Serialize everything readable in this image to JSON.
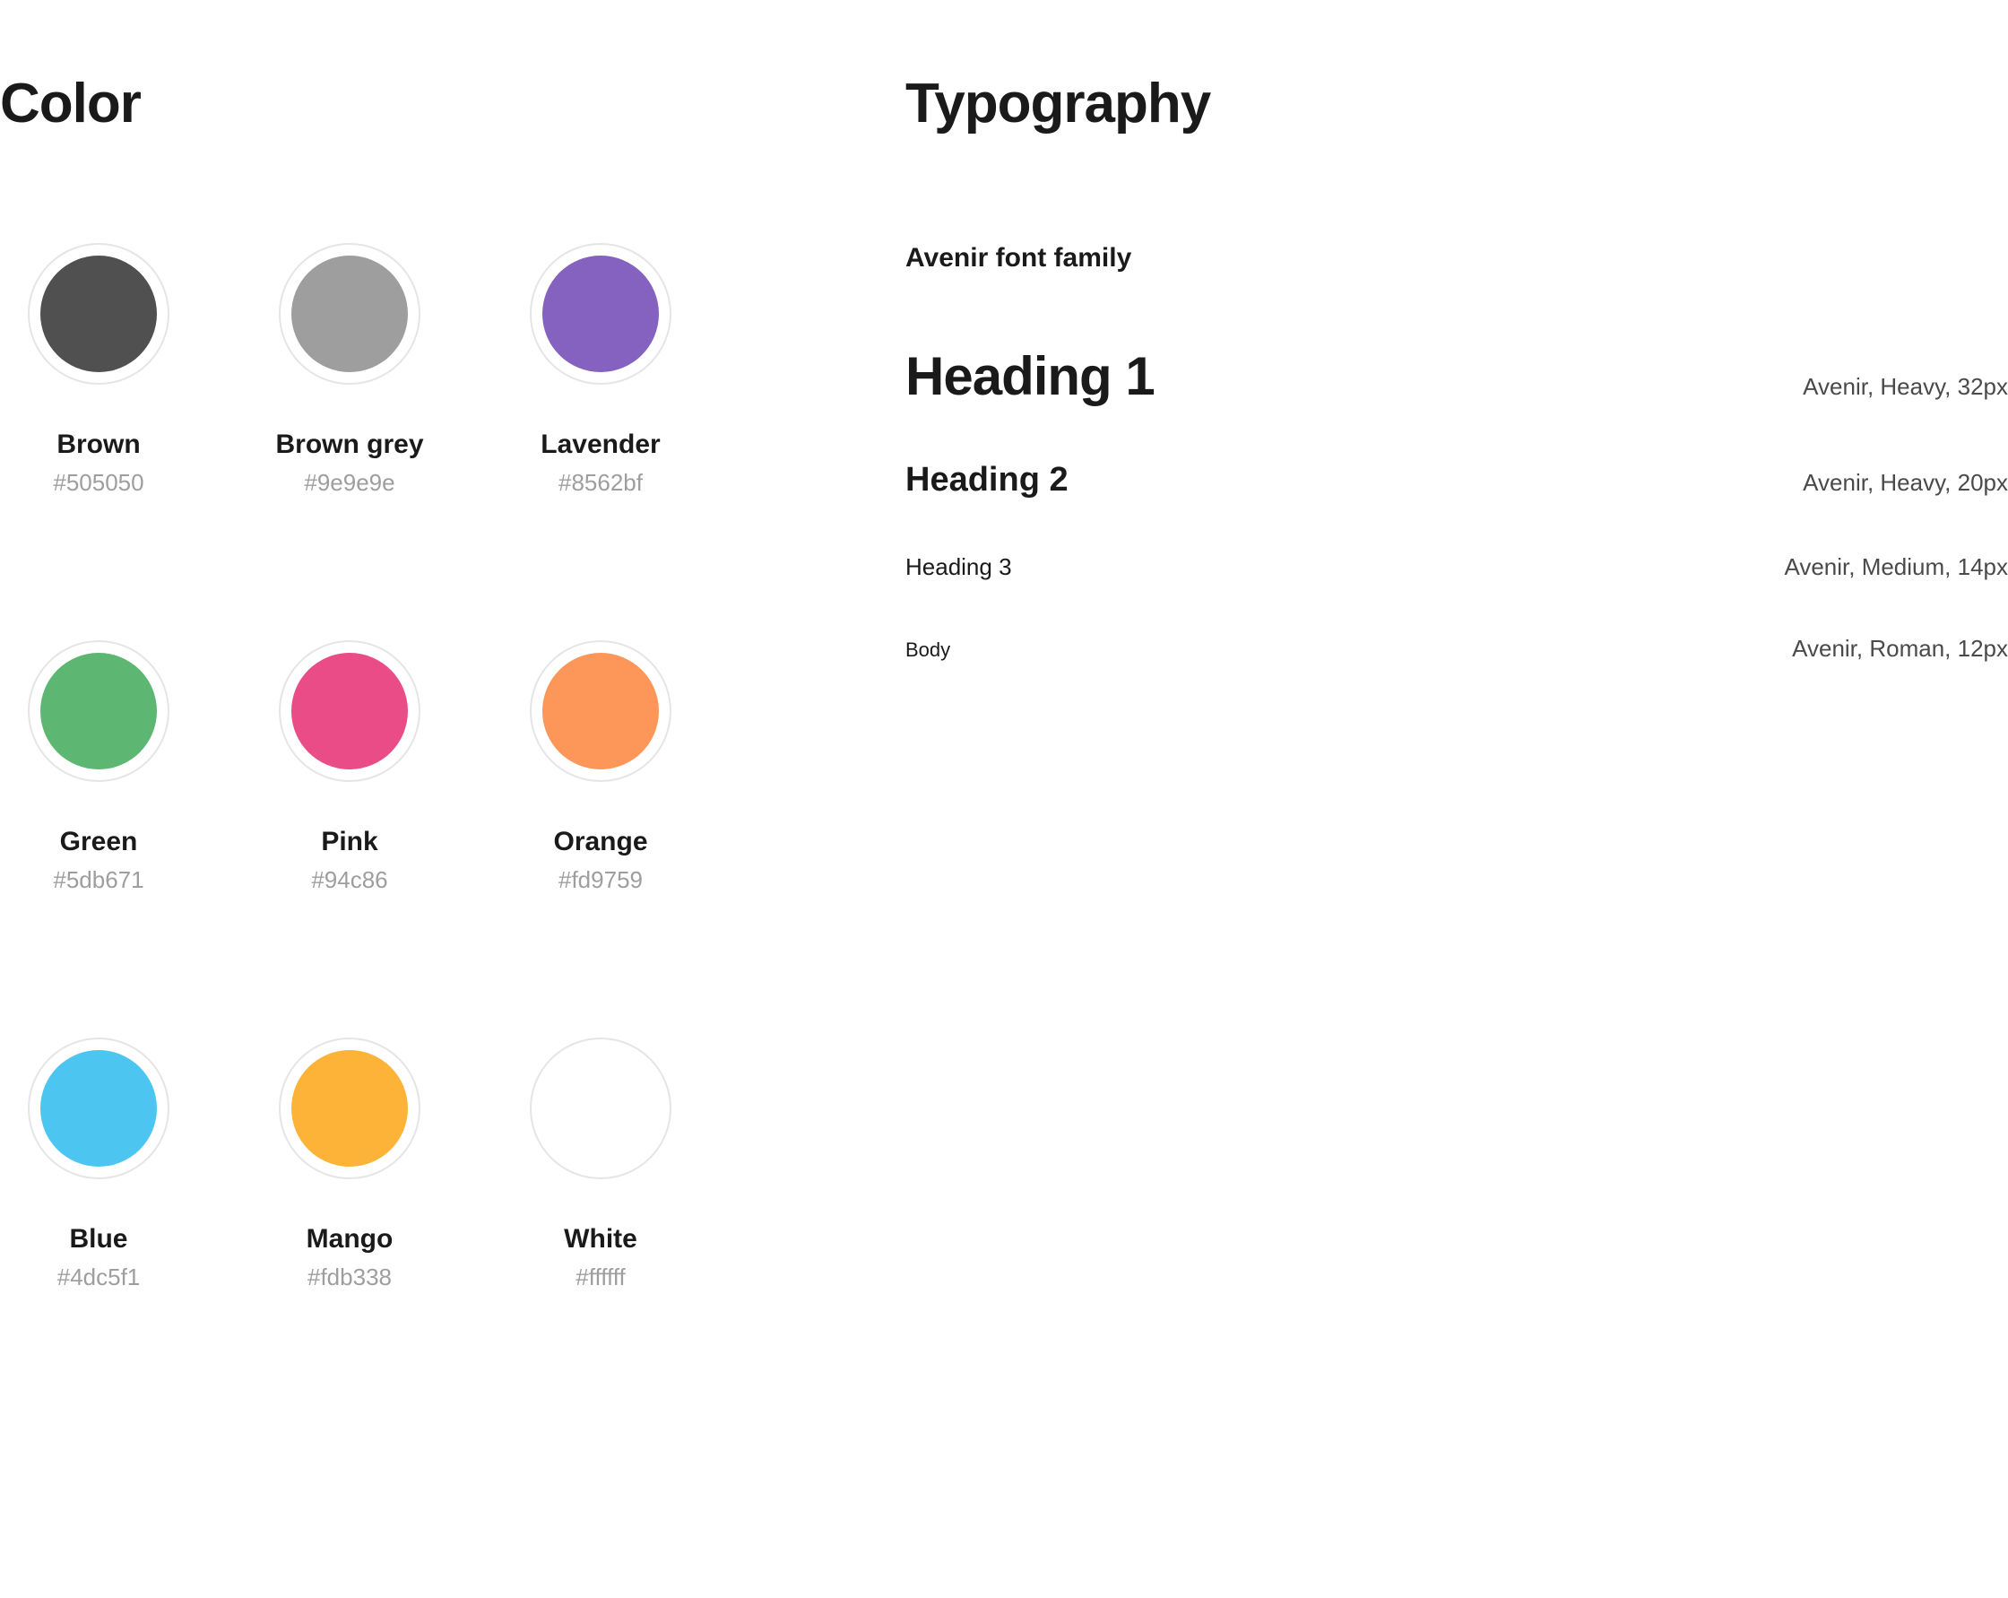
{
  "color": {
    "title": "Color",
    "swatches": [
      {
        "name": "Brown",
        "hex": "#505050",
        "fill": "#505050"
      },
      {
        "name": "Brown grey",
        "hex": "#9e9e9e",
        "fill": "#9e9e9e"
      },
      {
        "name": "Lavender",
        "hex": "#8562bf",
        "fill": "#8562bf"
      },
      {
        "name": "Green",
        "hex": "#5db671",
        "fill": "#5db671"
      },
      {
        "name": "Pink",
        "hex": "#94c86",
        "fill": "#e94c86"
      },
      {
        "name": "Orange",
        "hex": "#fd9759",
        "fill": "#fd9759"
      },
      {
        "name": "Blue",
        "hex": "#4dc5f1",
        "fill": "#4dc5f1"
      },
      {
        "name": "Mango",
        "hex": "#fdb338",
        "fill": "#fdb338"
      },
      {
        "name": "White",
        "hex": "#ffffff",
        "fill": "#ffffff"
      }
    ]
  },
  "typography": {
    "title": "Typography",
    "family": "Avenir font family",
    "rows": [
      {
        "label": "Heading 1",
        "spec": "Avenir, Heavy, 32px",
        "cls": "type-h1"
      },
      {
        "label": "Heading 2",
        "spec": "Avenir, Heavy, 20px",
        "cls": "type-h2"
      },
      {
        "label": "Heading 3",
        "spec": "Avenir, Medium, 14px",
        "cls": "type-h3"
      },
      {
        "label": "Body",
        "spec": "Avenir, Roman, 12px",
        "cls": "type-body"
      }
    ]
  }
}
